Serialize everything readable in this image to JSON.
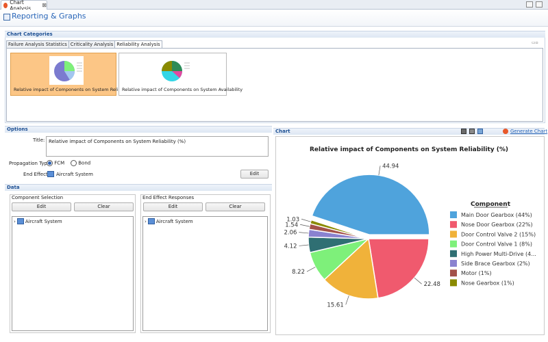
{
  "window": {
    "tab_title": "Chart Analysis",
    "close": "⊠"
  },
  "header": {
    "title": "Reporting & Graphs"
  },
  "categories": {
    "section_title": "Chart Categories",
    "tabs": [
      {
        "label": "Failure Analysis Statistics"
      },
      {
        "label": "Criticality Analysis"
      },
      {
        "label": "Reliability Analysis",
        "active": true
      }
    ],
    "thumbs": [
      {
        "label": "Relative impact of Components on System Reliability",
        "selected": true
      },
      {
        "label": "Relative impact of Components on System Availability",
        "selected": false
      }
    ]
  },
  "options": {
    "section_title": "Options",
    "title_label": "Title:",
    "title_value": "Relative impact of Components on System Reliability (%)",
    "propagation_label": "Propagation Type:",
    "prop_fcm": "FCM",
    "prop_bond": "Bond",
    "prop_selected": "FCM",
    "end_effect_label": "End Effect:",
    "end_effect_value": "Aircraft System",
    "edit": "Edit"
  },
  "data": {
    "section_title": "Data",
    "component_selection": "Component Selection",
    "end_effect_responses": "End Effect Responses",
    "edit": "Edit",
    "clear": "Clear",
    "tree_item": "Aircraft System"
  },
  "chart_panel": {
    "section_title": "Chart",
    "generate": "Generate Chart"
  },
  "chart_data": {
    "type": "pie",
    "title": "Relative impact of Components on System Reliability (%)",
    "legend_title": "Component",
    "legend_position": "right",
    "slices": [
      {
        "label": "Main Door Gearbox (44%)",
        "value": 44.94,
        "color": "#4fa3dc"
      },
      {
        "label": "Nose Door Gearbox (22%)",
        "value": 22.48,
        "color": "#f05a6e"
      },
      {
        "label": "Door Control Valve 2 (15%)",
        "value": 15.61,
        "color": "#f0b23a"
      },
      {
        "label": "Door Control Valve 1 (8%)",
        "value": 8.22,
        "color": "#7ef07a"
      },
      {
        "label": "High Power Multi-Drive (4...",
        "value": 4.12,
        "color": "#2f6f73"
      },
      {
        "label": "Side Brace Gearbox (2%)",
        "value": 2.06,
        "color": "#8a82d0"
      },
      {
        "label": "Motor (1%)",
        "value": 1.54,
        "color": "#a3514a"
      },
      {
        "label": "Nose Gearbox (1%)",
        "value": 1.03,
        "color": "#8a8a00"
      }
    ]
  }
}
